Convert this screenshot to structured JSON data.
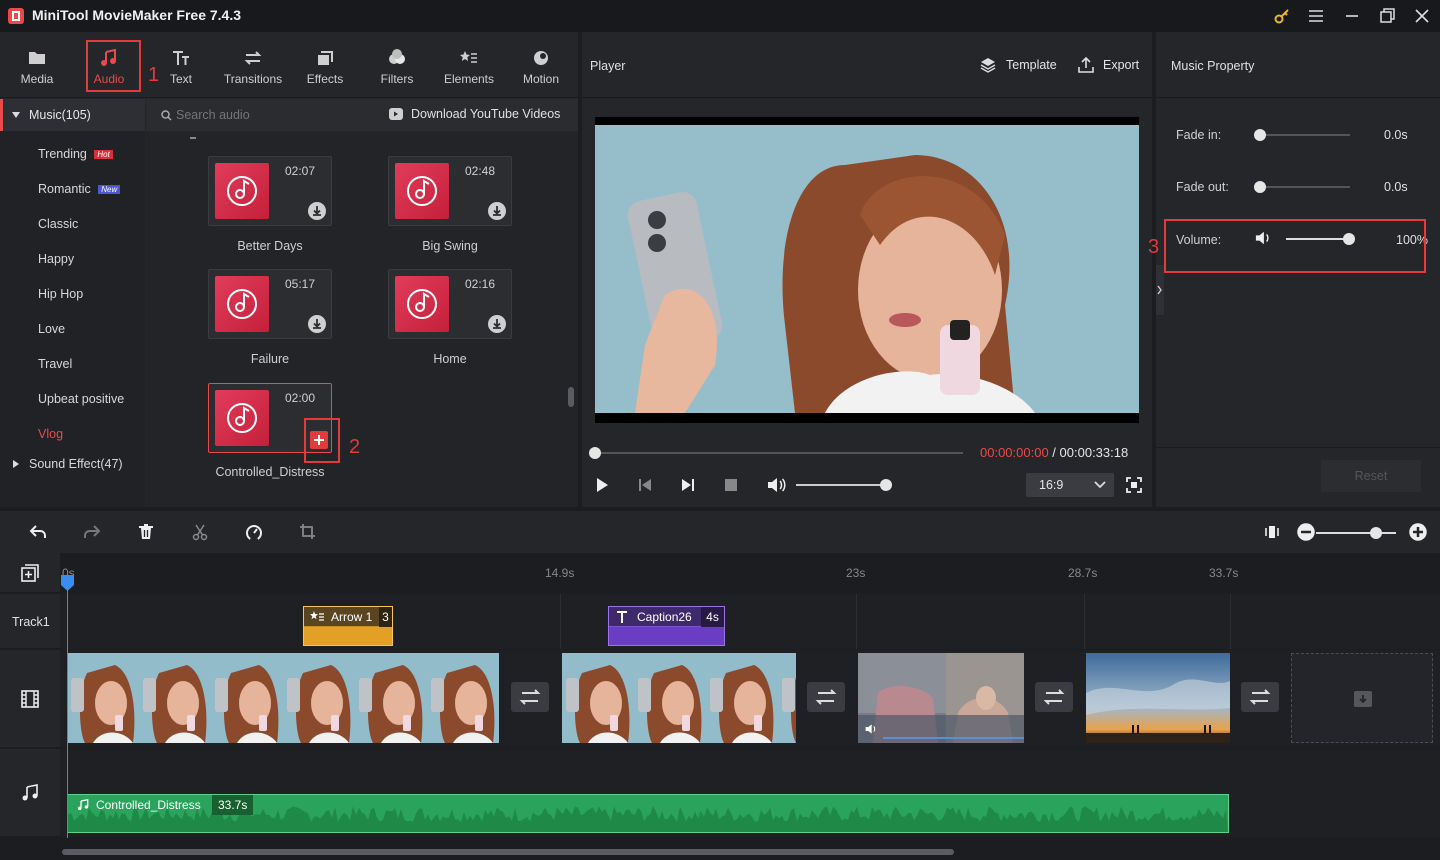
{
  "app": {
    "title": "MiniTool MovieMaker Free 7.4.3",
    "accent_color": "#e84b4b",
    "annotation_color": "#e23b3b"
  },
  "window_controls": [
    "key-icon",
    "menu-icon",
    "minimize-icon",
    "maximize-icon",
    "close-icon"
  ],
  "toolbar": {
    "tabs": [
      {
        "label": "Media",
        "icon": "media-folder-icon"
      },
      {
        "label": "Audio",
        "icon": "music-note-icon",
        "active": true
      },
      {
        "label": "Text",
        "icon": "text-icon"
      },
      {
        "label": "Transitions",
        "icon": "transitions-icon"
      },
      {
        "label": "Effects",
        "icon": "effects-icon"
      },
      {
        "label": "Filters",
        "icon": "filters-icon"
      },
      {
        "label": "Elements",
        "icon": "elements-icon"
      },
      {
        "label": "Motion",
        "icon": "motion-icon"
      }
    ]
  },
  "audio_sidebar": {
    "music_header": "Music(105)",
    "categories": [
      {
        "label": "Trending",
        "badge": "Hot",
        "badge_color": "#d6303a"
      },
      {
        "label": "Romantic",
        "badge": "New",
        "badge_color": "#4b57d8"
      },
      {
        "label": "Classic"
      },
      {
        "label": "Happy"
      },
      {
        "label": "Hip Hop"
      },
      {
        "label": "Love"
      },
      {
        "label": "Travel"
      },
      {
        "label": "Upbeat positive"
      },
      {
        "label": "Vlog",
        "active": true
      }
    ],
    "sound_effect_header": "Sound Effect(47)"
  },
  "audio_library": {
    "search_placeholder": "Search audio",
    "download_label": "Download YouTube Videos",
    "tracks": [
      {
        "name": "Better Days",
        "duration": "02:07"
      },
      {
        "name": "Big Swing",
        "duration": "02:48"
      },
      {
        "name": "Failure",
        "duration": "05:17"
      },
      {
        "name": "Home",
        "duration": "02:16"
      },
      {
        "name": "Controlled_Distress",
        "duration": "02:00",
        "selected": true
      }
    ]
  },
  "player": {
    "title": "Player",
    "template_label": "Template",
    "export_label": "Export",
    "current_time": "00:00:00:00",
    "separator": " / ",
    "total_time": "00:00:33:18",
    "aspect_ratio": "16:9",
    "progress": 0,
    "volume": 0.7
  },
  "music_property": {
    "title": "Music Property",
    "fade_in_label": "Fade in:",
    "fade_in_value": "0.0s",
    "fade_out_label": "Fade out:",
    "fade_out_value": "0.0s",
    "volume_label": "Volume:",
    "volume_value": "100%",
    "reset_label": "Reset"
  },
  "annotations": [
    "1",
    "2",
    "3"
  ],
  "timeline": {
    "ruler_marks": [
      "0s",
      "14.9s",
      "23s",
      "28.7s",
      "33.7s"
    ],
    "track_label": "Track1",
    "overlay_clips": [
      {
        "label": "Arrow 1",
        "extra": "3",
        "color": "#e2a124"
      },
      {
        "label": "Caption26",
        "extra": "4s",
        "color": "#6a3dc2"
      }
    ],
    "audio_clip": {
      "name": "Controlled_Distress",
      "duration": "33.7s",
      "color": "#2aa35c"
    },
    "zoom": 0.75
  }
}
